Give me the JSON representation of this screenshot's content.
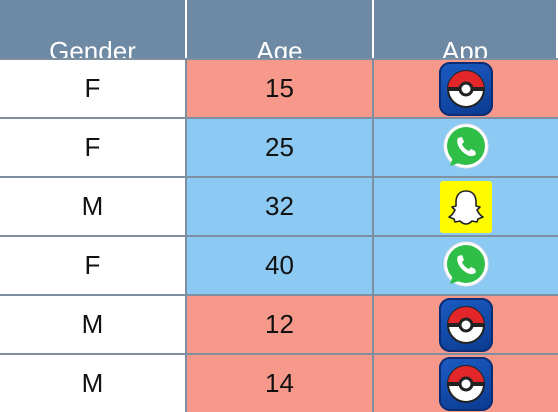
{
  "table": {
    "headers": [
      "Gender",
      "Age",
      "App"
    ],
    "rows": [
      {
        "gender": "F",
        "age": "15",
        "app": "pokemon-go-icon",
        "row_color": "#f7998a"
      },
      {
        "gender": "F",
        "age": "25",
        "app": "whatsapp-icon",
        "row_color": "#8cc9f3"
      },
      {
        "gender": "M",
        "age": "32",
        "app": "snapchat-icon",
        "row_color": "#8cc9f3"
      },
      {
        "gender": "F",
        "age": "40",
        "app": "whatsapp-icon",
        "row_color": "#8cc9f3"
      },
      {
        "gender": "M",
        "age": "12",
        "app": "pokemon-go-icon",
        "row_color": "#f7998a"
      },
      {
        "gender": "M",
        "age": "14",
        "app": "pokemon-go-icon",
        "row_color": "#f7998a"
      }
    ]
  },
  "colors": {
    "header_bg": "#6e89a3",
    "pink": "#f7998a",
    "blue": "#8cc9f3"
  }
}
